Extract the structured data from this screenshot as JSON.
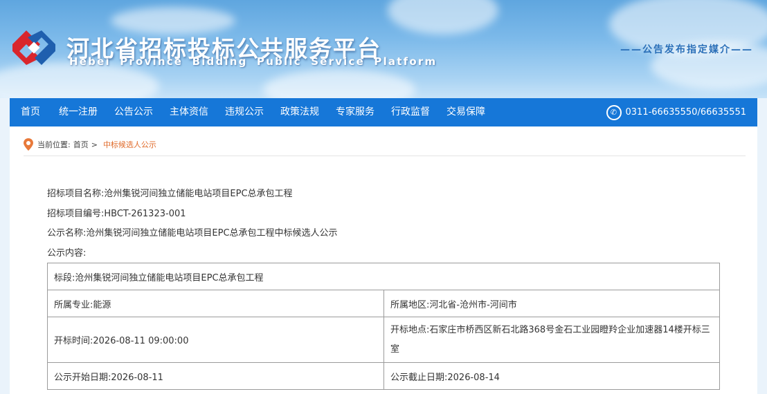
{
  "header": {
    "title": "河北省招标投标公共服务平台",
    "subtitle": "Hebei Province Bidding Public Service Platform",
    "slogan": "——公告发布指定媒介——"
  },
  "nav": {
    "items": [
      "首页",
      "统一注册",
      "公告公示",
      "主体资信",
      "违规公示",
      "政策法规",
      "专家服务",
      "行政监督",
      "交易保障"
    ],
    "phone": "0311-66635550/66635551"
  },
  "breadcrumb": {
    "label": "当前位置:",
    "home": "首页",
    "separator": ">",
    "current": "中标候选人公示"
  },
  "notice": {
    "project_name_label": "招标项目名称:",
    "project_name": "沧州集锐河间独立储能电站项目EPC总承包工程",
    "project_code_label": "招标项目编号:",
    "project_code": "HBCT-261323-001",
    "notice_name_label": "公示名称:",
    "notice_name": "沧州集锐河间独立储能电站项目EPC总承包工程中标候选人公示",
    "content_label": "公示内容:"
  },
  "table": {
    "section_label": "标段:",
    "section": "沧州集锐河间独立储能电站项目EPC总承包工程",
    "major_label": "所属专业:",
    "major": "能源",
    "region_label": "所属地区:",
    "region": "河北省-沧州市-河间市",
    "open_time_label": "开标时间:",
    "open_time": "2026-08-11 09:00:00",
    "open_place_label": "开标地点:",
    "open_place": "石家庄市桥西区新石北路368号金石工业园瞪羚企业加速器14楼开标三室",
    "start_date_label": "公示开始日期:",
    "start_date": "2026-08-11",
    "end_date_label": "公示截止日期:",
    "end_date": "2026-08-14"
  },
  "colors": {
    "nav_bg": "#1677d8",
    "accent": "#e06b2b",
    "slogan": "#2a6fb8"
  }
}
